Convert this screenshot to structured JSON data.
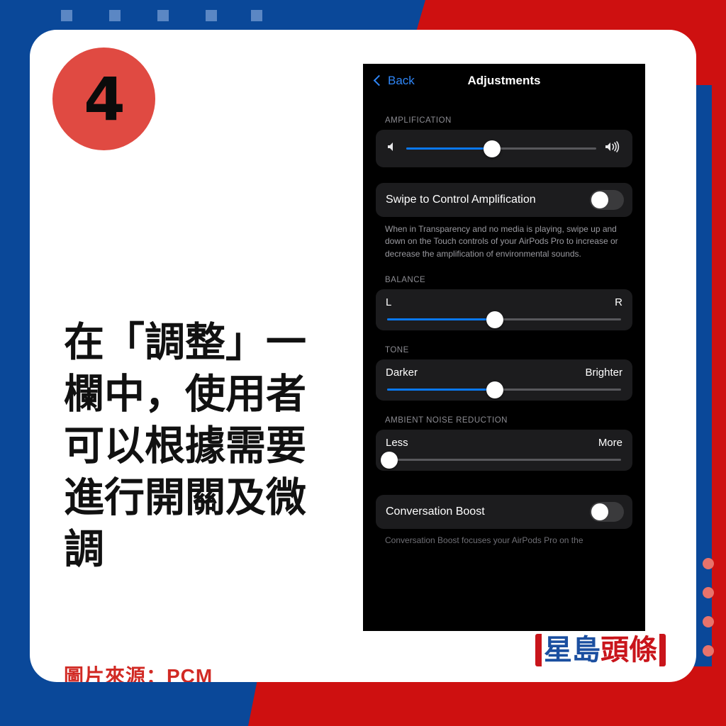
{
  "theme": {
    "blue": "#0a4899",
    "red": "#ce1010",
    "badge_red": "#e04a42",
    "accent_blue": "#0a78f0",
    "source_red": "#d12a24",
    "top_square": "#5b87c4",
    "edge_dot": "#e8736b"
  },
  "decor": {
    "top_squares": [
      128,
      196,
      264,
      332,
      396
    ],
    "edge_dots": [
      787,
      828,
      869,
      910
    ]
  },
  "card": {
    "step_number": "4",
    "caption": "在「調整」一欄中，使用者可以根據需要進行開關及微調",
    "source": "圖片來源：PCM",
    "logo": {
      "part1": "星島",
      "part2": "頭條"
    }
  },
  "phone": {
    "nav": {
      "back_label": "Back",
      "title": "Adjustments",
      "back_icon": "chevron-left-icon"
    },
    "sections": [
      {
        "label": "AMPLIFICATION",
        "type": "slider_row",
        "left_icon": "speaker-low-icon",
        "right_icon": "speaker-high-icon",
        "value_pct": 45
      },
      {
        "type": "toggle",
        "label": "Swipe to Control Amplification",
        "on": false,
        "note": "When in Transparency and no media is playing, swipe up and down on the Touch controls of your AirPods Pro to increase or decrease the amplification of environmental sounds."
      },
      {
        "label": "BALANCE",
        "type": "range",
        "left_label": "L",
        "right_label": "R",
        "value_pct": 46
      },
      {
        "label": "TONE",
        "type": "range",
        "left_label": "Darker",
        "right_label": "Brighter",
        "value_pct": 46
      },
      {
        "label": "AMBIENT NOISE REDUCTION",
        "type": "range",
        "left_label": "Less",
        "right_label": "More",
        "value_pct": 1
      },
      {
        "type": "toggle",
        "label": "Conversation Boost",
        "on": false,
        "note": "Conversation Boost focuses your AirPods Pro on the"
      }
    ]
  }
}
